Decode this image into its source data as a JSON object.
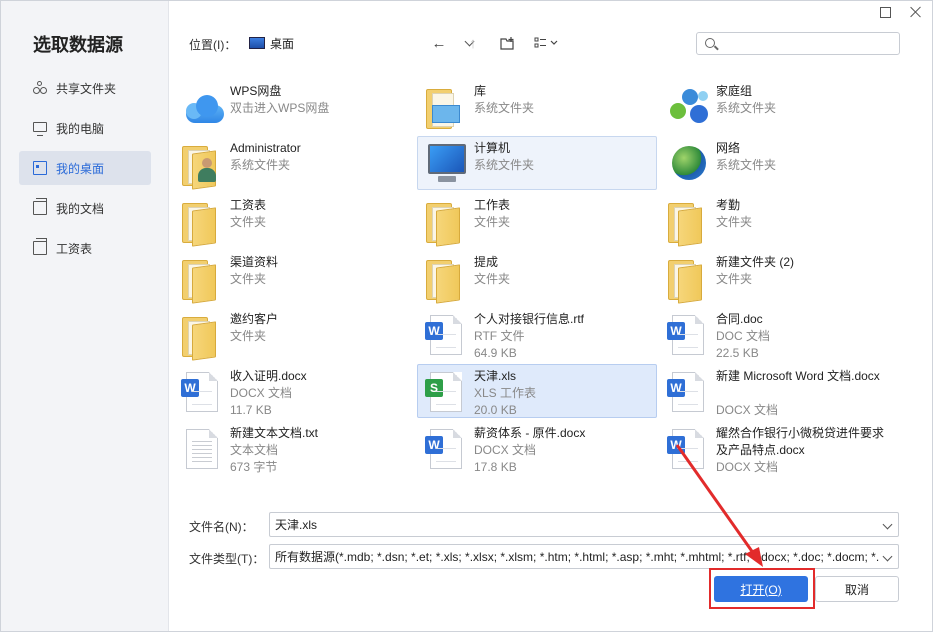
{
  "sidebar": {
    "title": "选取数据源",
    "items": [
      {
        "label": "共享文件夹",
        "icon": "share-icon"
      },
      {
        "label": "我的电脑",
        "icon": "computer-icon"
      },
      {
        "label": "我的桌面",
        "icon": "desktop-icon",
        "active": true
      },
      {
        "label": "我的文档",
        "icon": "documents-icon"
      },
      {
        "label": "工资表",
        "icon": "folder-icon"
      }
    ]
  },
  "toolbar": {
    "location_label": "位置(I)：",
    "location_value": "桌面"
  },
  "files": [
    {
      "name": "WPS网盘",
      "meta1": "双击进入WPS网盘",
      "meta2": ""
    },
    {
      "name": "库",
      "meta1": "系统文件夹",
      "meta2": ""
    },
    {
      "name": "家庭组",
      "meta1": "系统文件夹",
      "meta2": ""
    },
    {
      "name": "Administrator",
      "meta1": "系统文件夹",
      "meta2": ""
    },
    {
      "name": "计算机",
      "meta1": "系统文件夹",
      "meta2": ""
    },
    {
      "name": "网络",
      "meta1": "系统文件夹",
      "meta2": ""
    },
    {
      "name": "工资表",
      "meta1": "文件夹",
      "meta2": ""
    },
    {
      "name": "工作表",
      "meta1": "文件夹",
      "meta2": ""
    },
    {
      "name": "考勤",
      "meta1": "文件夹",
      "meta2": ""
    },
    {
      "name": "渠道资料",
      "meta1": "文件夹",
      "meta2": ""
    },
    {
      "name": "提成",
      "meta1": "文件夹",
      "meta2": ""
    },
    {
      "name": "新建文件夹 (2)",
      "meta1": "文件夹",
      "meta2": ""
    },
    {
      "name": "邀约客户",
      "meta1": "文件夹",
      "meta2": ""
    },
    {
      "name": "个人对接银行信息.rtf",
      "meta1": "RTF 文件",
      "meta2": "64.9 KB"
    },
    {
      "name": "合同.doc",
      "meta1": "DOC 文档",
      "meta2": "22.5 KB"
    },
    {
      "name": "收入证明.docx",
      "meta1": "DOCX 文档",
      "meta2": "11.7 KB"
    },
    {
      "name": "天津.xls",
      "meta1": "XLS 工作表",
      "meta2": "20.0 KB"
    },
    {
      "name": "新建 Microsoft Word 文档.docx",
      "meta1": "DOCX 文档",
      "meta2": ""
    },
    {
      "name": "新建文本文档.txt",
      "meta1": "文本文档",
      "meta2": "673 字节"
    },
    {
      "name": "薪资体系 - 原件.docx",
      "meta1": "DOCX 文档",
      "meta2": "17.8 KB"
    },
    {
      "name": "耀然合作银行小微税贷进件要求及产品特点.docx",
      "meta1": "DOCX 文档",
      "meta2": ""
    }
  ],
  "form": {
    "filename_label": "文件名(N)：",
    "filename_value": "天津.xls",
    "filetype_label": "文件类型(T)：",
    "filetype_value": "所有数据源(*.mdb; *.dsn; *.et; *.xls; *.xlsx; *.xlsm; *.htm; *.html; *.asp; *.mht; *.mhtml; *.rtf; *.docx; *.doc; *.docm; *."
  },
  "buttons": {
    "open_label": "打开(O)",
    "cancel_label": "取消"
  },
  "colors": {
    "accent": "#2f73e0",
    "annotation_red": "#e22b2b",
    "selected_bg": "#dfeafb"
  }
}
